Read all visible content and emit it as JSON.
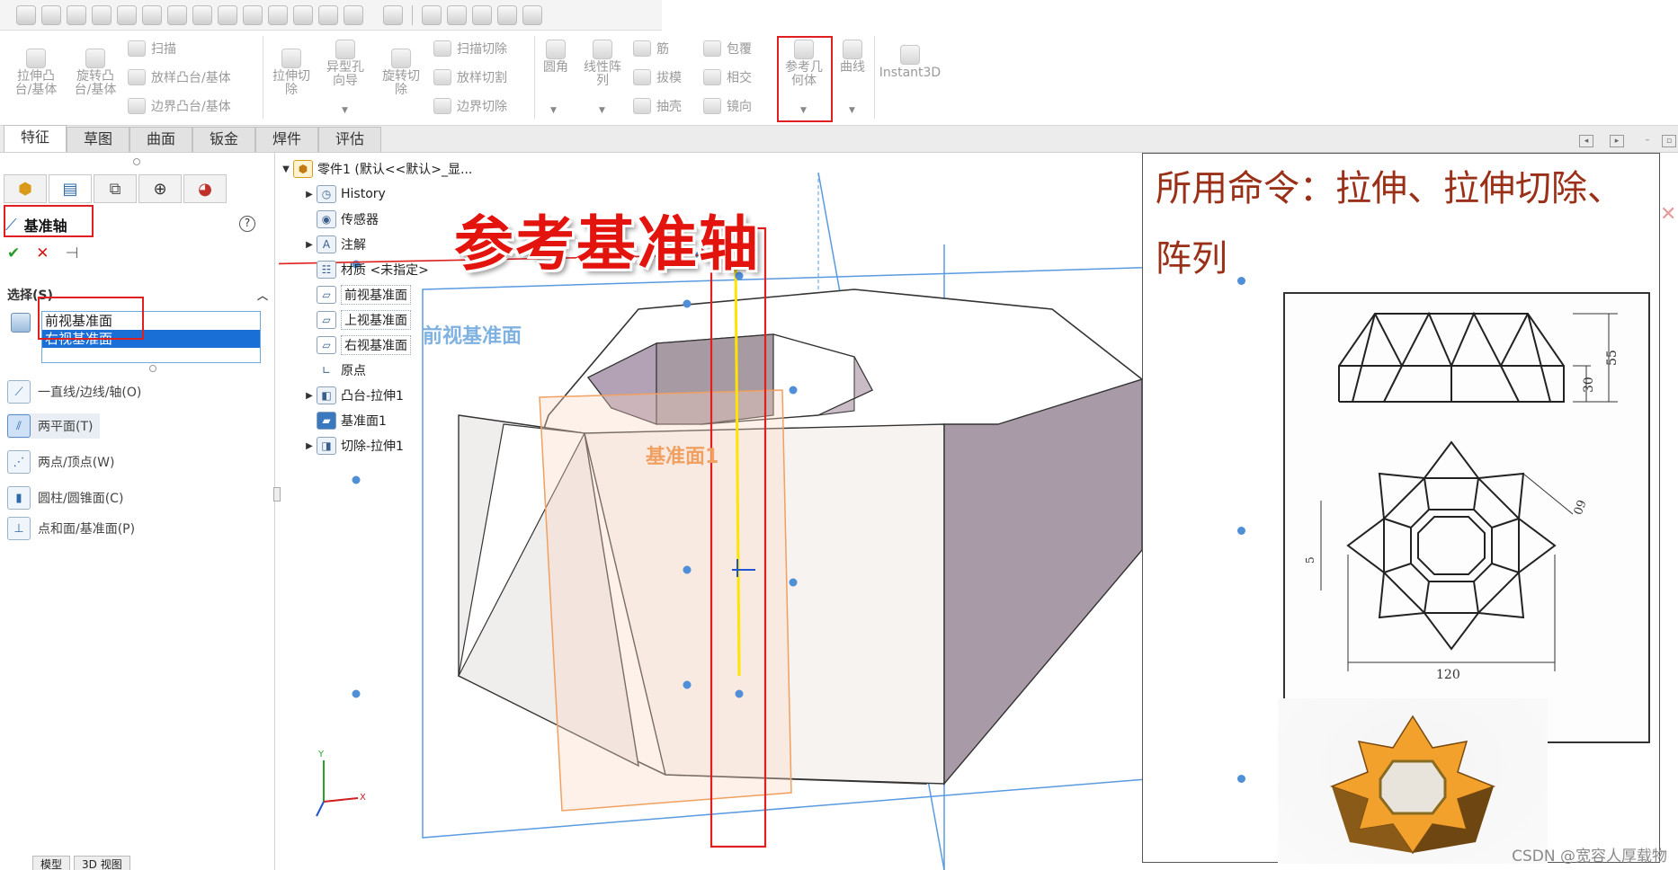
{
  "ribbon": {
    "extrude_boss": "拉伸凸\n台/基体",
    "revolve_boss": "旋转凸\n台/基体",
    "sweep": "扫描",
    "loft_boss": "放样凸台/基体",
    "boundary_boss": "边界凸台/基体",
    "extrude_cut": "拉伸切\n除",
    "hole_wizard": "异型孔\n向导",
    "revolve_cut": "旋转切\n除",
    "sweep_cut": "扫描切除",
    "loft_cut": "放样切割",
    "boundary_cut": "边界切除",
    "fillet": "圆角",
    "linear_pattern": "线性阵\n列",
    "rib": "筋",
    "draft": "拔模",
    "shell": "抽壳",
    "wrap": "包覆",
    "intersect": "相交",
    "mirror": "镜向",
    "ref_geometry": "参考几\n何体",
    "curves": "曲线",
    "instant3d": "Instant3D"
  },
  "tabs": [
    {
      "label": "特征",
      "active": true
    },
    {
      "label": "草图",
      "active": false
    },
    {
      "label": "曲面",
      "active": false
    },
    {
      "label": "钣金",
      "active": false
    },
    {
      "label": "焊件",
      "active": false
    },
    {
      "label": "评估",
      "active": false
    }
  ],
  "property_manager": {
    "title": "基准轴",
    "help": "?",
    "ok": "✔",
    "cancel": "✕",
    "pin": "⊣",
    "selection_header": "选择(S)",
    "selection_items": [
      {
        "label": "前视基准面",
        "selected": false
      },
      {
        "label": "右视基准面",
        "selected": true
      }
    ],
    "options": [
      {
        "label": "一直线/边线/轴(O)",
        "icon": "line-edge-axis-icon",
        "pressed": false
      },
      {
        "label": "两平面(T)",
        "icon": "two-planes-icon",
        "pressed": true
      },
      {
        "label": "两点/顶点(W)",
        "icon": "two-points-icon",
        "pressed": false
      },
      {
        "label": "圆柱/圆锥面(C)",
        "icon": "cylinder-cone-icon",
        "pressed": false
      },
      {
        "label": "点和面/基准面(P)",
        "icon": "point-face-icon",
        "pressed": false
      }
    ]
  },
  "bottom_tabs": [
    "模型",
    "3D 视图"
  ],
  "feature_tree": {
    "root": "零件1  (默认<<默认>_显...",
    "items": [
      {
        "label": "History",
        "icon": "history-icon",
        "expandable": true,
        "plane": false
      },
      {
        "label": "传感器",
        "icon": "sensor-icon",
        "expandable": false,
        "plane": false
      },
      {
        "label": "注解",
        "icon": "annotation-icon",
        "expandable": true,
        "plane": false
      },
      {
        "label": "材质 <未指定>",
        "icon": "material-icon",
        "expandable": false,
        "plane": false
      },
      {
        "label": "前视基准面",
        "icon": "plane-icon",
        "expandable": false,
        "plane": true
      },
      {
        "label": "上视基准面",
        "icon": "plane-icon",
        "expandable": false,
        "plane": true
      },
      {
        "label": "右视基准面",
        "icon": "plane-icon",
        "expandable": false,
        "plane": true
      },
      {
        "label": "原点",
        "icon": "origin-icon",
        "expandable": false,
        "plane": false
      },
      {
        "label": "凸台-拉伸1",
        "icon": "boss-extrude-icon",
        "expandable": true,
        "plane": false
      },
      {
        "label": "基准面1",
        "icon": "plane1-icon",
        "expandable": false,
        "plane": false
      },
      {
        "label": "切除-拉伸1",
        "icon": "cut-extrude-icon",
        "expandable": true,
        "plane": false
      }
    ]
  },
  "viewport": {
    "caption": "参考基准轴",
    "plane_label_front": "前视基准面",
    "plane_label_1": "基准面1",
    "triad_y": "Y",
    "triad_x": "X"
  },
  "reference": {
    "line1": "所用命令：拉伸、拉伸切除、",
    "line2": "阵列",
    "dim_55": "55",
    "dim_30": "30",
    "dim_60": "60",
    "dim_5": "5",
    "dim_120": "120"
  },
  "watermark": "CSDN @宽容人厚载物",
  "colors": {
    "highlight_red": "#e02020",
    "plane_blue": "#4f8fd8",
    "plane_orange": "#f0a060",
    "axis_yellow": "#ffe400",
    "selection_blue": "#1a6fd6"
  }
}
